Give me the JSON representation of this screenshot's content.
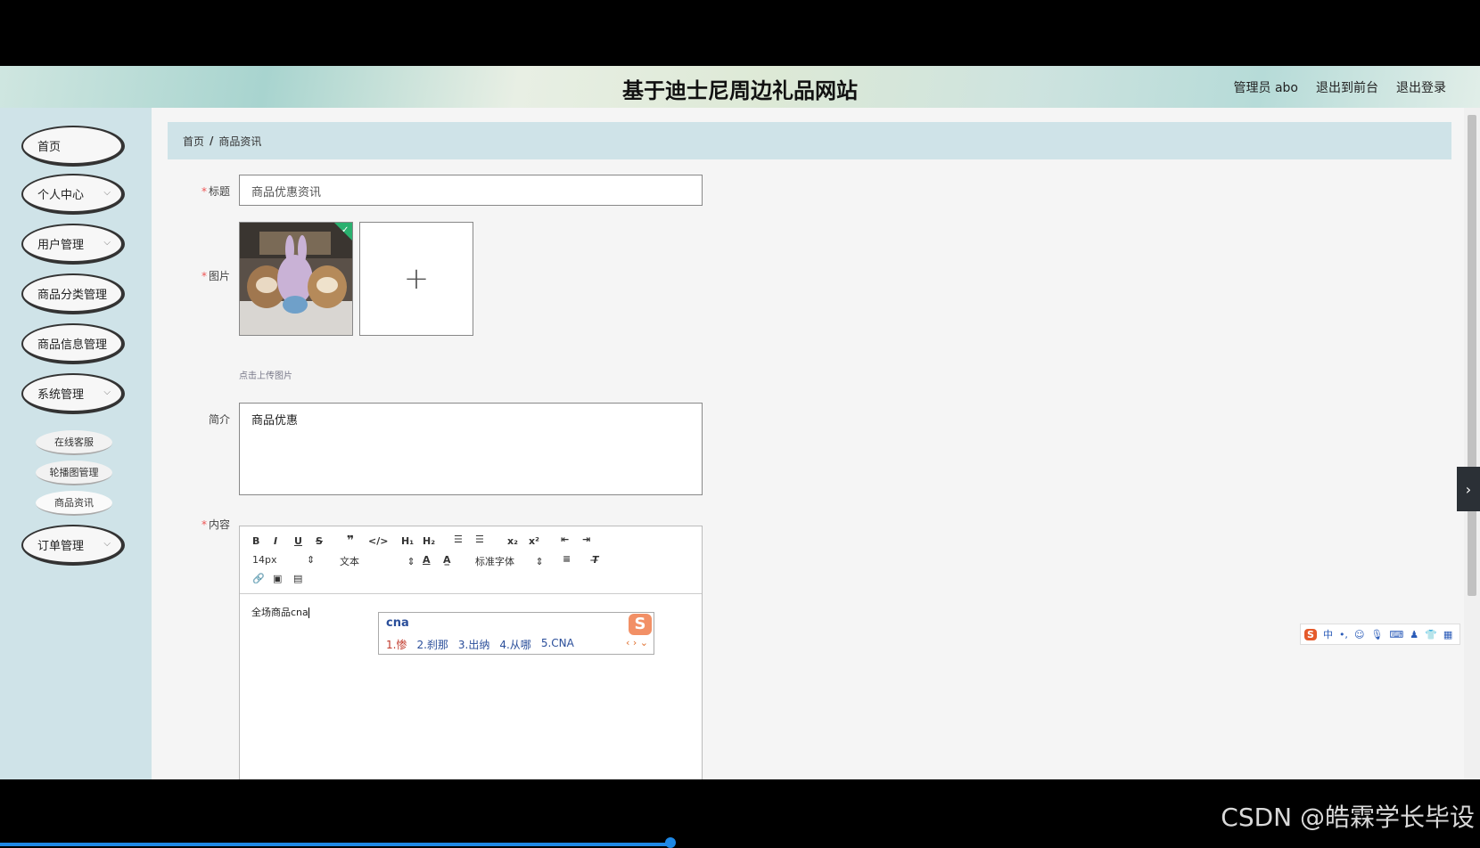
{
  "header": {
    "title": "基于迪士尼周边礼品网站",
    "admin_label": "管理员 abo",
    "to_front_label": "退出到前台",
    "logout_label": "退出登录"
  },
  "sidebar": {
    "items": [
      {
        "label": "首页",
        "has_chevron": false
      },
      {
        "label": "个人中心",
        "has_chevron": true
      },
      {
        "label": "用户管理",
        "has_chevron": true
      },
      {
        "label": "商品分类管理",
        "has_chevron": false
      },
      {
        "label": "商品信息管理",
        "has_chevron": false
      },
      {
        "label": "系统管理",
        "has_chevron": true
      }
    ],
    "sub_items": [
      {
        "label": "在线客服"
      },
      {
        "label": "轮播图管理"
      },
      {
        "label": "商品资讯",
        "active": true
      }
    ],
    "last_item": {
      "label": "订单管理",
      "has_chevron": true
    }
  },
  "breadcrumb": {
    "home": "首页",
    "separator": "/",
    "current": "商品资讯"
  },
  "form": {
    "title_label": "标题",
    "title_value": "商品优惠资讯",
    "image_label": "图片",
    "upload_hint": "点击上传图片",
    "intro_label": "简介",
    "intro_value": "商品优惠",
    "content_label": "内容",
    "required_mark": "*"
  },
  "editor": {
    "font_size": "14px",
    "format": "文本",
    "font_family": "标准字体",
    "body_text": "全场商品cna"
  },
  "ime": {
    "input": "cna",
    "candidates": [
      "1.惨",
      "2.刹那",
      "3.出纳",
      "4.从哪",
      "5.CNA"
    ],
    "logo": "S"
  },
  "ime_bar": {
    "mode": "中"
  },
  "watermark": "CSDN @皓霖学长毕设"
}
